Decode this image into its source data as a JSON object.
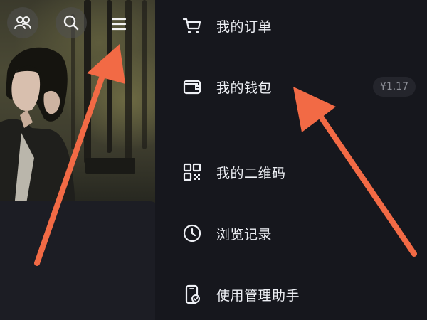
{
  "menu": {
    "orders_label": "我的订单",
    "wallet_label": "我的钱包",
    "wallet_balance": "¥1.17",
    "qrcode_label": "我的二维码",
    "history_label": "浏览记录",
    "assistant_label": "使用管理助手"
  },
  "icons": {
    "friends": "friends-icon",
    "search": "search-icon",
    "menu": "hamburger-menu-icon",
    "cart": "cart-icon",
    "wallet": "wallet-icon",
    "qrcode": "qrcode-icon",
    "clock": "clock-icon",
    "phone_check": "phone-check-icon",
    "arrows": "pointer-arrow-icon"
  },
  "colors": {
    "drawer_bg": "#16171d",
    "text": "#eef0f5",
    "badge_bg": "#24252c",
    "badge_text": "#8c8e96",
    "arrow": "#f26a45"
  }
}
